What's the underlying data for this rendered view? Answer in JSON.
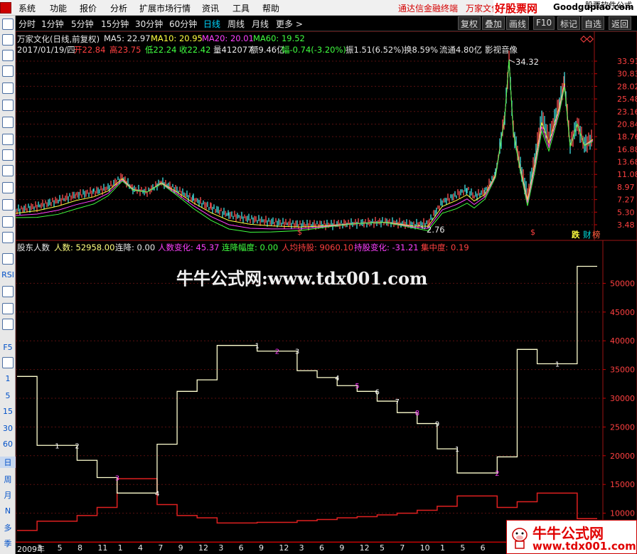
{
  "menu": {
    "items": [
      "系统",
      "功能",
      "报价",
      "分析",
      "扩展市场行情",
      "资讯",
      "工具",
      "帮助"
    ],
    "promo1": "通达信金融终端",
    "promo2": "万家文化",
    "brand_cn": "好股票网",
    "brand_en": "Goodgupiao.com",
    "right_text": "股票软件公式"
  },
  "toolbar": {
    "periods": [
      "分时",
      "1分钟",
      "5分钟",
      "15分钟",
      "30分钟",
      "60分钟",
      "日线",
      "周线",
      "月线",
      "更多 >"
    ],
    "active": "日线",
    "buttons": [
      "复权",
      "叠加",
      "画线",
      "F10",
      "标记",
      "自选",
      "返回"
    ]
  },
  "sidebar": {
    "labels": [
      "RSI",
      "F5",
      "1",
      "5",
      "15",
      "30",
      "60",
      "日",
      "周",
      "月",
      "N",
      "多",
      "季"
    ]
  },
  "price_panel": {
    "title": "万家文化(日线,前复权)",
    "ma5": "MA5: 22.97",
    "ma10": "MA10: 20.95",
    "ma20": "MA20: 20.01",
    "ma60": "MA60: 19.52",
    "date": "2017/01/19/四",
    "open": "开22.84",
    "high": "高23.75",
    "low": "低22.24",
    "close": "收22.42",
    "volume": "量412077",
    "amount": "额9.46亿",
    "change": "幅-0.74(-3.20%)",
    "amplitude": "振1.51(6.52%)",
    "turnover": "换8.59%",
    "float": "流通4.80亿",
    "concept": "影视音像",
    "max_label": "34.32",
    "min_label": "2.76",
    "y_ticks": [
      "33.91",
      "30.83",
      "28.02",
      "25.48",
      "23.16",
      "20.84",
      "18.76",
      "16.88",
      "13.68",
      "11.08",
      "8.97",
      "7.27",
      "5.30",
      "3.48"
    ],
    "badge1": "跌",
    "badge2": "财",
    "badge3": "榜"
  },
  "indicator_panel": {
    "name": "股东人数",
    "holders": "人数: 52958.00",
    "consecutive_drop": "连降: 0.00",
    "holder_change": "人数变化: 45.37",
    "drop_amplitude": "连降幅度: 0.00",
    "avg_hold": "人均持股: 9060.10",
    "hold_change": "持股变化: -31.21",
    "concentration": "集中度: 0.19",
    "y_ticks": [
      "50000",
      "45000",
      "40000",
      "35000",
      "30000",
      "25000",
      "20000",
      "15000",
      "10000"
    ]
  },
  "chart_data": {
    "type": "line",
    "series": [
      {
        "name": "人数",
        "values": [
          33800,
          33800,
          21800,
          21800,
          19200,
          16200,
          13500,
          13500,
          22000,
          31200,
          33200,
          39200,
          39200,
          38200,
          38200,
          34800,
          33600,
          32200,
          31200,
          29500,
          27500,
          25600,
          21200,
          17000,
          17000,
          19800,
          38500,
          36000,
          36000,
          52958
        ]
      },
      {
        "name": "人均持股",
        "values": [
          7000,
          7000,
          8600,
          8600,
          9600,
          11000,
          16000,
          16000,
          11500,
          9600,
          9200,
          8300,
          8300,
          8400,
          8400,
          8700,
          8900,
          9200,
          9400,
          9700,
          10000,
          10500,
          11200,
          13000,
          13000,
          11000,
          12000,
          13500,
          13500,
          9060
        ]
      }
    ],
    "ylim": [
      5000,
      55000
    ]
  },
  "x_axis": {
    "labels": [
      "2009年",
      "3",
      "5",
      "8",
      "11",
      "1",
      "4",
      "7",
      "9",
      "12",
      "3",
      "6",
      "9",
      "12",
      "3",
      "6",
      "9",
      "12",
      "5",
      "7",
      "10",
      "1",
      "5",
      "6"
    ]
  },
  "watermark": {
    "main": "牛牛公式网:www.tdx001.com",
    "corner_cn": "牛牛公式网",
    "corner_en": "www.tdx001.com"
  }
}
